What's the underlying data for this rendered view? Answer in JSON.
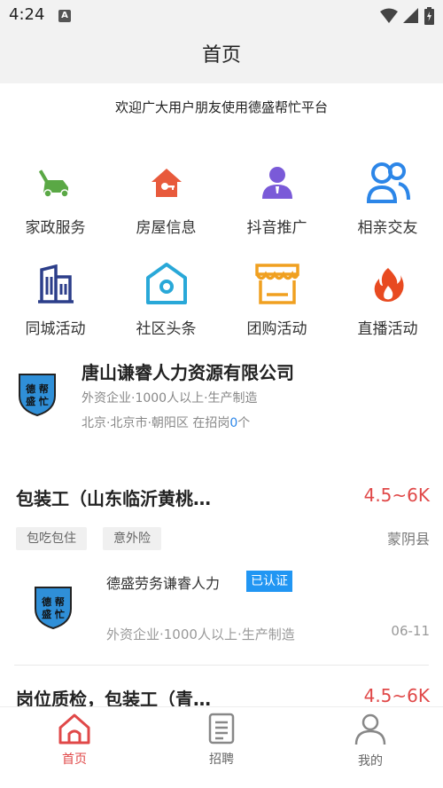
{
  "status_bar": {
    "time": "4:24",
    "app_icon": "A"
  },
  "header": {
    "title": "首页"
  },
  "welcome": "欢迎广大用户朋友使用德盛帮忙平台",
  "grid": [
    {
      "label": "家政服务",
      "icon": "lawnmower-icon",
      "color": "#5aa845"
    },
    {
      "label": "房屋信息",
      "icon": "house-icon",
      "color": "#e85a3c"
    },
    {
      "label": "抖音推广",
      "icon": "person-icon",
      "color": "#7a5ad8"
    },
    {
      "label": "相亲交友",
      "icon": "people-icon",
      "color": "#2c86e8"
    },
    {
      "label": "同城活动",
      "icon": "buildings-icon",
      "color": "#2c3e8a"
    },
    {
      "label": "社区头条",
      "icon": "location-house-icon",
      "color": "#29a8d8"
    },
    {
      "label": "团购活动",
      "icon": "shop-icon",
      "color": "#f0a020"
    },
    {
      "label": "直播活动",
      "icon": "fire-icon",
      "color": "#e84a20"
    }
  ],
  "company": {
    "name": "唐山谦睿人力资源有限公司",
    "meta": "外资企业·1000人以上·生产制造",
    "location": "北京·北京市·朝阳区 在招岗",
    "open_count": "0",
    "count_suffix": "个",
    "logo_text": "德盛帮忙"
  },
  "jobs": [
    {
      "title": "包装工（山东临沂黄桃…",
      "salary": "4.5~6K",
      "tags": [
        "包吃包住",
        "意外险"
      ],
      "location": "蒙阴县",
      "company": "德盛劳务谦睿人力",
      "verified": "已认证",
      "meta": "外资企业·1000人以上·生产制造",
      "date": "06-11"
    },
    {
      "title": "岗位质检，包装工（青…",
      "salary": "4.5~6K"
    }
  ],
  "tabbar": [
    {
      "label": "首页",
      "icon": "home-icon",
      "active": true
    },
    {
      "label": "招聘",
      "icon": "document-icon",
      "active": false
    },
    {
      "label": "我的",
      "icon": "user-icon",
      "active": false
    }
  ],
  "colors": {
    "accent": "#e04848",
    "blue": "#2c86e8",
    "verified": "#2196f3"
  }
}
